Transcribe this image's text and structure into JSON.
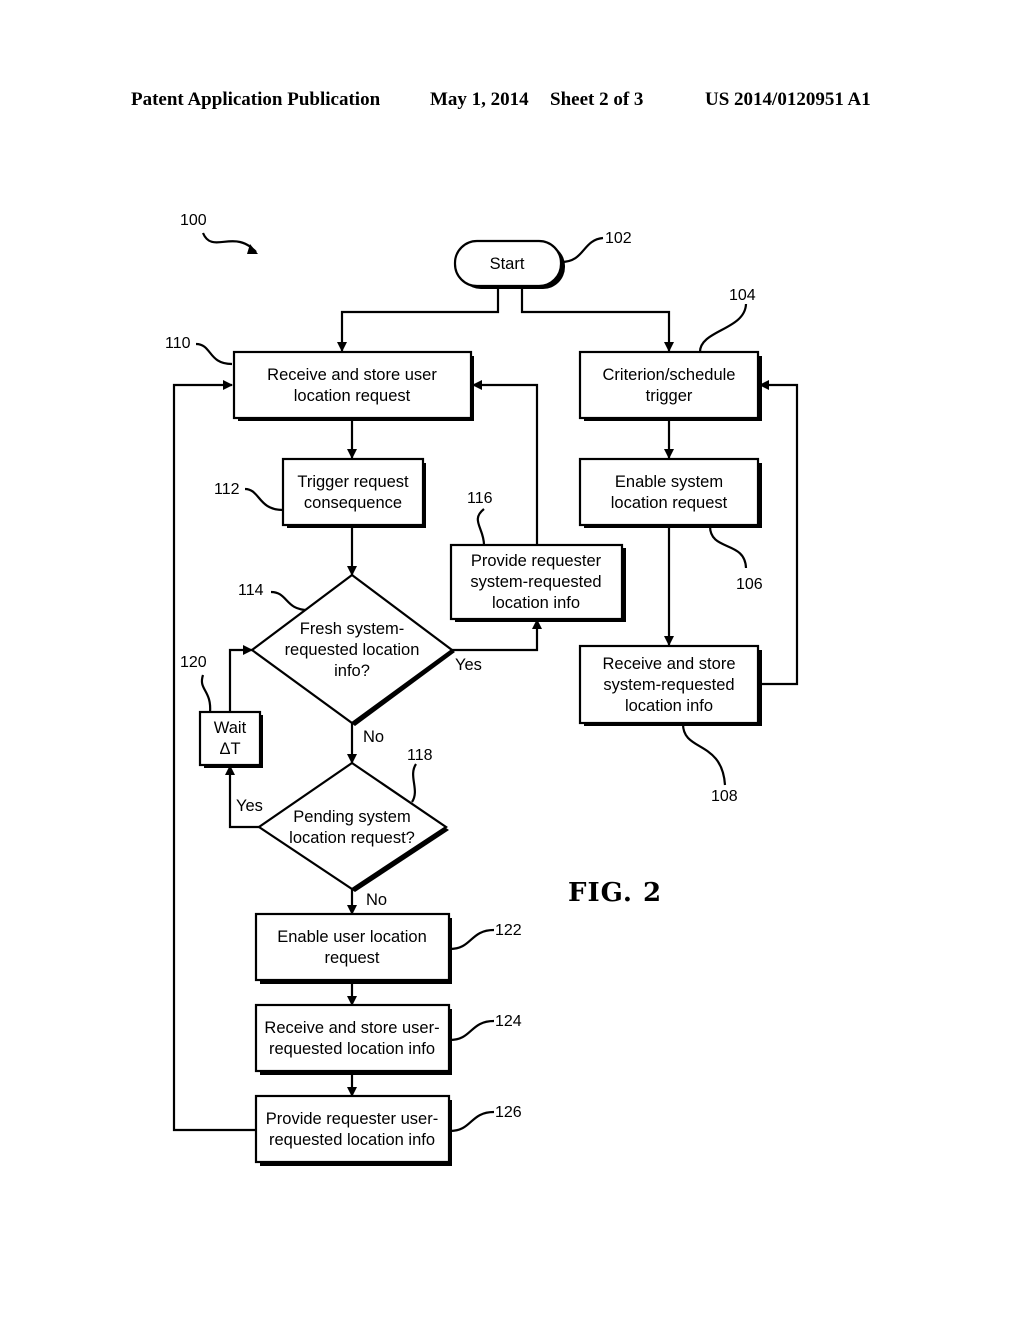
{
  "header": {
    "publication": "Patent Application Publication",
    "date": "May 1, 2014",
    "sheet": "Sheet 2 of 3",
    "number": "US 2014/0120951 A1"
  },
  "figure": {
    "label": "FIG. 2",
    "ref": "100"
  },
  "nodes": {
    "start": {
      "ref": "102",
      "lines": [
        "Start"
      ]
    },
    "criterion": {
      "ref": "104",
      "lines": [
        "Criterion/schedule",
        "trigger"
      ]
    },
    "enable_system": {
      "ref": "106",
      "lines": [
        "Enable system",
        "location request"
      ]
    },
    "receive_system": {
      "ref": "108",
      "lines": [
        "Receive and store",
        "system-requested",
        "location info"
      ]
    },
    "receive_user_request": {
      "ref": "110",
      "lines": [
        "Receive and store user",
        "location request"
      ]
    },
    "trigger_consequence": {
      "ref": "112",
      "lines": [
        "Trigger request",
        "consequence"
      ]
    },
    "fresh_decision": {
      "ref": "114",
      "lines": [
        "Fresh system-",
        "requested location",
        "info?"
      ]
    },
    "provide_system": {
      "ref": "116",
      "lines": [
        "Provide requester",
        "system-requested",
        "location info"
      ]
    },
    "pending_decision": {
      "ref": "118",
      "lines": [
        "Pending system",
        "location request?"
      ]
    },
    "wait": {
      "ref": "120",
      "lines": [
        "Wait",
        "ΔT"
      ]
    },
    "enable_user": {
      "ref": "122",
      "lines": [
        "Enable user location",
        "request"
      ]
    },
    "receive_user_info": {
      "ref": "124",
      "lines": [
        "Receive and store user-",
        "requested location info"
      ]
    },
    "provide_user": {
      "ref": "126",
      "lines": [
        "Provide requester user-",
        "requested location info"
      ]
    }
  },
  "edge_labels": {
    "fresh_yes": "Yes",
    "fresh_no": "No",
    "pending_yes": "Yes",
    "pending_no": "No"
  }
}
